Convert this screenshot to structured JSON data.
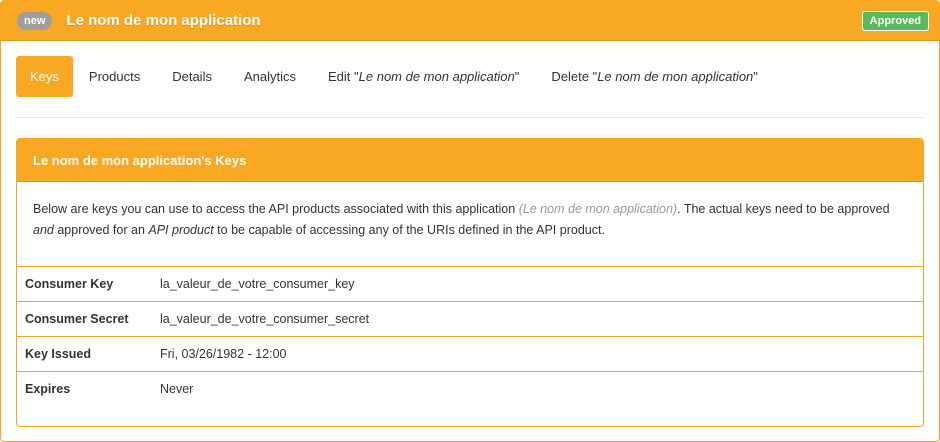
{
  "header": {
    "new_badge": "new",
    "app_title": "Le nom de mon application",
    "status_badge": "Approved"
  },
  "tabs": [
    {
      "label": "Keys",
      "active": true
    },
    {
      "label": "Products"
    },
    {
      "label": "Details"
    },
    {
      "label": "Analytics"
    },
    {
      "prefix": "Edit \"",
      "name": "Le nom de mon application",
      "suffix": "\""
    },
    {
      "prefix": "Delete \"",
      "name": "Le nom de mon application",
      "suffix": "\""
    }
  ],
  "panel": {
    "heading": "Le nom de mon application's Keys",
    "desc_1": "Below are keys you can use to access the API products associated with this application ",
    "desc_app": "(Le nom de mon application)",
    "desc_2": ". The actual keys need to be approved ",
    "desc_and": "and",
    "desc_3": " approved for an ",
    "desc_api": "API product",
    "desc_4": " to be capable of accessing any of the URIs defined in the API product."
  },
  "keys": [
    {
      "label": "Consumer Key",
      "value": "la_valeur_de_votre_consumer_key"
    },
    {
      "label": "Consumer Secret",
      "value": "la_valeur_de_votre_consumer_secret"
    },
    {
      "label": "Key Issued",
      "value": "Fri, 03/26/1982 - 12:00"
    },
    {
      "label": "Expires",
      "value": "Never"
    }
  ],
  "colors": {
    "accent": "#f8a823",
    "approved": "#5cb85c",
    "new_badge": "#9e9e9e"
  }
}
